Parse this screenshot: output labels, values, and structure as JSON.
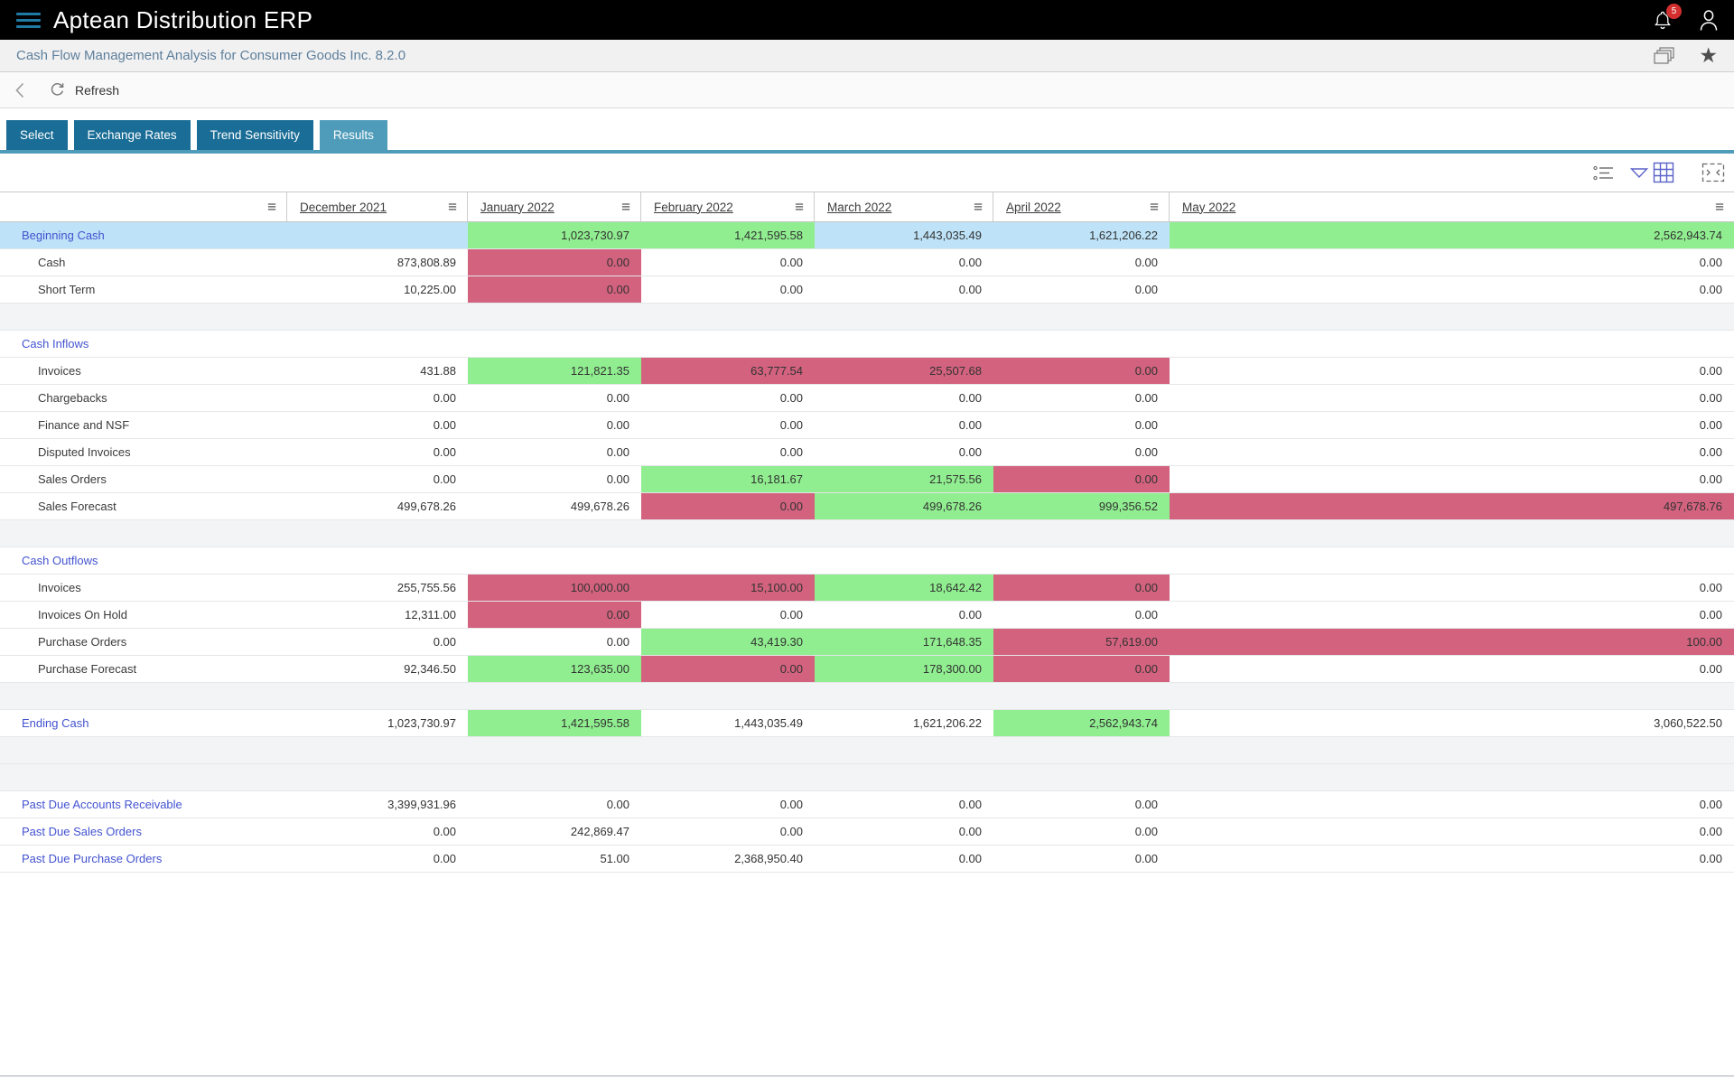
{
  "app": {
    "title": "Aptean Distribution ERP",
    "notification_count": "5"
  },
  "breadcrumb": {
    "title": "Cash Flow Management Analysis for Consumer Goods Inc. 8.2.0"
  },
  "toolbar": {
    "refresh_label": "Refresh"
  },
  "tabs": [
    {
      "label": "Select",
      "active": false
    },
    {
      "label": "Exchange Rates",
      "active": false
    },
    {
      "label": "Trend Sensitivity",
      "active": false
    },
    {
      "label": "Results",
      "active": true
    }
  ],
  "icons": {
    "topbar": [
      "menu-icon",
      "bell-icon",
      "person-icon"
    ],
    "breadcrumb": [
      "windows-icon",
      "star-icon"
    ],
    "grid_toolbar": [
      "row-density-icon",
      "chevron-down-icon",
      "grid-columns-icon",
      "fullscreen-icon"
    ]
  },
  "colors": {
    "tab_inactive": "#1a6d96",
    "tab_active": "#4f9cba",
    "positive_cell": "#90ee90",
    "negative_cell": "#d2627e",
    "highlight_cell": "#bee3f8",
    "link_text": "#4353d0",
    "badge": "#d32f2f"
  },
  "table": {
    "columns": [
      "",
      "December 2021",
      "January 2022",
      "February 2022",
      "March 2022",
      "April 2022",
      "May 2022"
    ],
    "rows": [
      {
        "label": "Beginning Cash",
        "type": "section",
        "label_bg": "blue",
        "cells": [
          {
            "v": "",
            "bg": "blue"
          },
          {
            "v": "1,023,730.97",
            "bg": "green"
          },
          {
            "v": "1,421,595.58",
            "bg": "green"
          },
          {
            "v": "1,443,035.49",
            "bg": "blue"
          },
          {
            "v": "1,621,206.22",
            "bg": "blue"
          },
          {
            "v": "2,562,943.74",
            "bg": "green"
          }
        ]
      },
      {
        "label": "Cash",
        "type": "item",
        "label_bg": "",
        "cells": [
          {
            "v": "873,808.89",
            "bg": ""
          },
          {
            "v": "0.00",
            "bg": "pink"
          },
          {
            "v": "0.00",
            "bg": ""
          },
          {
            "v": "0.00",
            "bg": ""
          },
          {
            "v": "0.00",
            "bg": ""
          },
          {
            "v": "0.00",
            "bg": ""
          }
        ]
      },
      {
        "label": "Short Term",
        "type": "item",
        "label_bg": "",
        "cells": [
          {
            "v": "10,225.00",
            "bg": ""
          },
          {
            "v": "0.00",
            "bg": "pink"
          },
          {
            "v": "0.00",
            "bg": ""
          },
          {
            "v": "0.00",
            "bg": ""
          },
          {
            "v": "0.00",
            "bg": ""
          },
          {
            "v": "0.00",
            "bg": ""
          }
        ]
      },
      {
        "label": "",
        "type": "blank",
        "label_bg": "",
        "cells": []
      },
      {
        "label": "Cash Inflows",
        "type": "section",
        "label_bg": "",
        "cells": [
          {
            "v": "",
            "bg": ""
          },
          {
            "v": "",
            "bg": ""
          },
          {
            "v": "",
            "bg": ""
          },
          {
            "v": "",
            "bg": ""
          },
          {
            "v": "",
            "bg": ""
          },
          {
            "v": "",
            "bg": ""
          }
        ]
      },
      {
        "label": "Invoices",
        "type": "item",
        "label_bg": "",
        "cells": [
          {
            "v": "431.88",
            "bg": ""
          },
          {
            "v": "121,821.35",
            "bg": "green"
          },
          {
            "v": "63,777.54",
            "bg": "pink"
          },
          {
            "v": "25,507.68",
            "bg": "pink"
          },
          {
            "v": "0.00",
            "bg": "pink"
          },
          {
            "v": "0.00",
            "bg": ""
          }
        ]
      },
      {
        "label": "Chargebacks",
        "type": "item",
        "label_bg": "",
        "cells": [
          {
            "v": "0.00",
            "bg": ""
          },
          {
            "v": "0.00",
            "bg": ""
          },
          {
            "v": "0.00",
            "bg": ""
          },
          {
            "v": "0.00",
            "bg": ""
          },
          {
            "v": "0.00",
            "bg": ""
          },
          {
            "v": "0.00",
            "bg": ""
          }
        ]
      },
      {
        "label": "Finance and NSF",
        "type": "item",
        "label_bg": "",
        "cells": [
          {
            "v": "0.00",
            "bg": ""
          },
          {
            "v": "0.00",
            "bg": ""
          },
          {
            "v": "0.00",
            "bg": ""
          },
          {
            "v": "0.00",
            "bg": ""
          },
          {
            "v": "0.00",
            "bg": ""
          },
          {
            "v": "0.00",
            "bg": ""
          }
        ]
      },
      {
        "label": "Disputed Invoices",
        "type": "item",
        "label_bg": "",
        "cells": [
          {
            "v": "0.00",
            "bg": ""
          },
          {
            "v": "0.00",
            "bg": ""
          },
          {
            "v": "0.00",
            "bg": ""
          },
          {
            "v": "0.00",
            "bg": ""
          },
          {
            "v": "0.00",
            "bg": ""
          },
          {
            "v": "0.00",
            "bg": ""
          }
        ]
      },
      {
        "label": "Sales Orders",
        "type": "item",
        "label_bg": "",
        "cells": [
          {
            "v": "0.00",
            "bg": ""
          },
          {
            "v": "0.00",
            "bg": ""
          },
          {
            "v": "16,181.67",
            "bg": "green"
          },
          {
            "v": "21,575.56",
            "bg": "green"
          },
          {
            "v": "0.00",
            "bg": "pink"
          },
          {
            "v": "0.00",
            "bg": ""
          }
        ]
      },
      {
        "label": "Sales Forecast",
        "type": "item",
        "label_bg": "",
        "cells": [
          {
            "v": "499,678.26",
            "bg": ""
          },
          {
            "v": "499,678.26",
            "bg": ""
          },
          {
            "v": "0.00",
            "bg": "pink"
          },
          {
            "v": "499,678.26",
            "bg": "green"
          },
          {
            "v": "999,356.52",
            "bg": "green"
          },
          {
            "v": "497,678.76",
            "bg": "pink"
          }
        ]
      },
      {
        "label": "",
        "type": "blank",
        "label_bg": "",
        "cells": []
      },
      {
        "label": "Cash Outflows",
        "type": "section",
        "label_bg": "",
        "cells": [
          {
            "v": "",
            "bg": ""
          },
          {
            "v": "",
            "bg": ""
          },
          {
            "v": "",
            "bg": ""
          },
          {
            "v": "",
            "bg": ""
          },
          {
            "v": "",
            "bg": ""
          },
          {
            "v": "",
            "bg": ""
          }
        ]
      },
      {
        "label": "Invoices",
        "type": "item",
        "label_bg": "",
        "cells": [
          {
            "v": "255,755.56",
            "bg": ""
          },
          {
            "v": "100,000.00",
            "bg": "pink"
          },
          {
            "v": "15,100.00",
            "bg": "pink"
          },
          {
            "v": "18,642.42",
            "bg": "green"
          },
          {
            "v": "0.00",
            "bg": "pink"
          },
          {
            "v": "0.00",
            "bg": ""
          }
        ]
      },
      {
        "label": "Invoices On Hold",
        "type": "item",
        "label_bg": "",
        "cells": [
          {
            "v": "12,311.00",
            "bg": ""
          },
          {
            "v": "0.00",
            "bg": "pink"
          },
          {
            "v": "0.00",
            "bg": ""
          },
          {
            "v": "0.00",
            "bg": ""
          },
          {
            "v": "0.00",
            "bg": ""
          },
          {
            "v": "0.00",
            "bg": ""
          }
        ]
      },
      {
        "label": "Purchase Orders",
        "type": "item",
        "label_bg": "",
        "cells": [
          {
            "v": "0.00",
            "bg": ""
          },
          {
            "v": "0.00",
            "bg": ""
          },
          {
            "v": "43,419.30",
            "bg": "green"
          },
          {
            "v": "171,648.35",
            "bg": "green"
          },
          {
            "v": "57,619.00",
            "bg": "pink"
          },
          {
            "v": "100.00",
            "bg": "pink"
          }
        ]
      },
      {
        "label": "Purchase Forecast",
        "type": "item",
        "label_bg": "",
        "cells": [
          {
            "v": "92,346.50",
            "bg": ""
          },
          {
            "v": "123,635.00",
            "bg": "green"
          },
          {
            "v": "0.00",
            "bg": "pink"
          },
          {
            "v": "178,300.00",
            "bg": "green"
          },
          {
            "v": "0.00",
            "bg": "pink"
          },
          {
            "v": "0.00",
            "bg": ""
          }
        ]
      },
      {
        "label": "",
        "type": "blank",
        "label_bg": "",
        "cells": []
      },
      {
        "label": "Ending Cash",
        "type": "section",
        "label_bg": "",
        "cells": [
          {
            "v": "1,023,730.97",
            "bg": ""
          },
          {
            "v": "1,421,595.58",
            "bg": "green"
          },
          {
            "v": "1,443,035.49",
            "bg": ""
          },
          {
            "v": "1,621,206.22",
            "bg": ""
          },
          {
            "v": "2,562,943.74",
            "bg": "green"
          },
          {
            "v": "3,060,522.50",
            "bg": ""
          }
        ]
      },
      {
        "label": "",
        "type": "blank",
        "label_bg": "",
        "cells": []
      },
      {
        "label": "",
        "type": "blank",
        "label_bg": "",
        "cells": []
      },
      {
        "label": "Past Due Accounts Receivable",
        "type": "section",
        "label_bg": "",
        "cells": [
          {
            "v": "3,399,931.96",
            "bg": ""
          },
          {
            "v": "0.00",
            "bg": ""
          },
          {
            "v": "0.00",
            "bg": ""
          },
          {
            "v": "0.00",
            "bg": ""
          },
          {
            "v": "0.00",
            "bg": ""
          },
          {
            "v": "0.00",
            "bg": ""
          }
        ]
      },
      {
        "label": "Past Due Sales Orders",
        "type": "section",
        "label_bg": "",
        "cells": [
          {
            "v": "0.00",
            "bg": ""
          },
          {
            "v": "242,869.47",
            "bg": ""
          },
          {
            "v": "0.00",
            "bg": ""
          },
          {
            "v": "0.00",
            "bg": ""
          },
          {
            "v": "0.00",
            "bg": ""
          },
          {
            "v": "0.00",
            "bg": ""
          }
        ]
      },
      {
        "label": "Past Due Purchase Orders",
        "type": "section",
        "label_bg": "",
        "cells": [
          {
            "v": "0.00",
            "bg": ""
          },
          {
            "v": "51.00",
            "bg": ""
          },
          {
            "v": "2,368,950.40",
            "bg": ""
          },
          {
            "v": "0.00",
            "bg": ""
          },
          {
            "v": "0.00",
            "bg": ""
          },
          {
            "v": "0.00",
            "bg": ""
          }
        ]
      }
    ]
  }
}
